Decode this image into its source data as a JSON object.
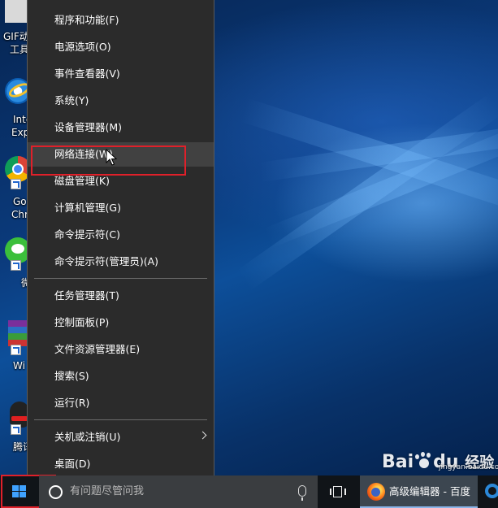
{
  "desktop": {
    "icons": [
      {
        "label": "GIF动",
        "label2": "工具"
      },
      {
        "label": "Inte",
        "label2": "Exp"
      },
      {
        "label": "Go",
        "label2": "Chr"
      },
      {
        "label": "微",
        "label2": ""
      },
      {
        "label": "Wi",
        "label2": ""
      },
      {
        "label": "腾讯",
        "label2": ""
      }
    ]
  },
  "context_menu": {
    "items": [
      {
        "label": "程序和功能(F)"
      },
      {
        "label": "电源选项(O)"
      },
      {
        "label": "事件查看器(V)"
      },
      {
        "label": "系统(Y)"
      },
      {
        "label": "设备管理器(M)"
      },
      {
        "label": "网络连接(W)"
      },
      {
        "label": "磁盘管理(K)"
      },
      {
        "label": "计算机管理(G)"
      },
      {
        "label": "命令提示符(C)"
      },
      {
        "label": "命令提示符(管理员)(A)"
      },
      {
        "label": "任务管理器(T)"
      },
      {
        "label": "控制面板(P)"
      },
      {
        "label": "文件资源管理器(E)"
      },
      {
        "label": "搜索(S)"
      },
      {
        "label": "运行(R)"
      },
      {
        "label": "关机或注销(U)"
      },
      {
        "label": "桌面(D)"
      }
    ],
    "highlighted_item": "网络连接(W)"
  },
  "taskbar": {
    "search_placeholder": "有问题尽管问我",
    "active_window_label": "高级编辑器 - 百度",
    "icons": [
      "windows-start-icon",
      "cortana-icon",
      "microphone-icon",
      "task-view-icon",
      "firefox-icon",
      "edge-icon"
    ]
  },
  "watermark": {
    "brand": "Bai",
    "brand2": "du",
    "suffix": "经验",
    "sub": "jingyan.baidu.com"
  },
  "colors": {
    "menu_bg": "#2b2b2b",
    "menu_hover": "#414141",
    "highlight_box": "#e0202a",
    "taskbar_bg": "#101418",
    "accent": "#3fa2ff"
  }
}
